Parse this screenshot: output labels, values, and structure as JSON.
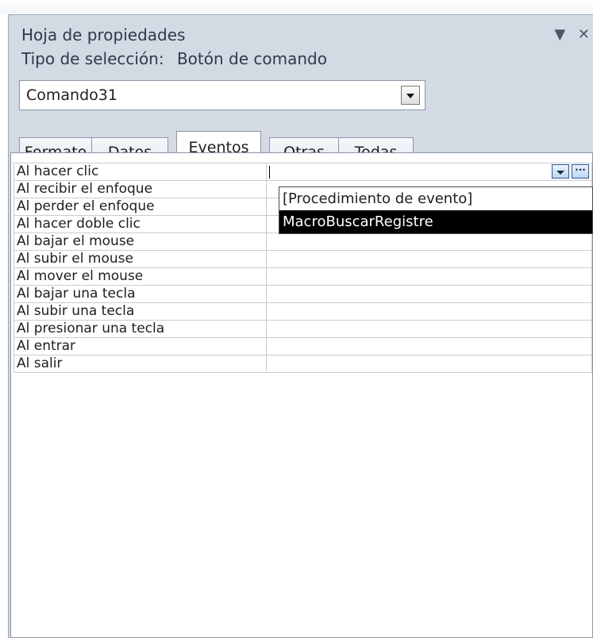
{
  "window": {
    "title": "Hoja de propiedades",
    "pin_glyph": "▼",
    "close_glyph": "✕"
  },
  "selection": {
    "label": "Tipo de selección:",
    "value": "Botón de comando"
  },
  "object_combo": {
    "value": "Comando31"
  },
  "tabs": [
    {
      "label": "Formato",
      "active": false
    },
    {
      "label": "Datos",
      "active": false
    },
    {
      "label": "Eventos",
      "active": true
    },
    {
      "label": "Otras",
      "active": false
    },
    {
      "label": "Todas",
      "active": false
    }
  ],
  "properties": [
    {
      "label": "Al hacer clic",
      "value": ""
    },
    {
      "label": "Al recibir el enfoque",
      "value": ""
    },
    {
      "label": "Al perder el enfoque",
      "value": ""
    },
    {
      "label": "Al hacer doble clic",
      "value": ""
    },
    {
      "label": "Al bajar el mouse",
      "value": ""
    },
    {
      "label": "Al subir el mouse",
      "value": ""
    },
    {
      "label": "Al mover el mouse",
      "value": ""
    },
    {
      "label": "Al bajar una tecla",
      "value": ""
    },
    {
      "label": "Al subir una tecla",
      "value": ""
    },
    {
      "label": "Al presionar una tecla",
      "value": ""
    },
    {
      "label": "Al entrar",
      "value": ""
    },
    {
      "label": "Al salir",
      "value": ""
    }
  ],
  "event_dropdown": {
    "options": [
      {
        "label": "[Procedimiento de evento]",
        "selected": false
      },
      {
        "label": "MacroBuscarRegistre",
        "selected": true
      }
    ],
    "build_glyph": "···"
  }
}
